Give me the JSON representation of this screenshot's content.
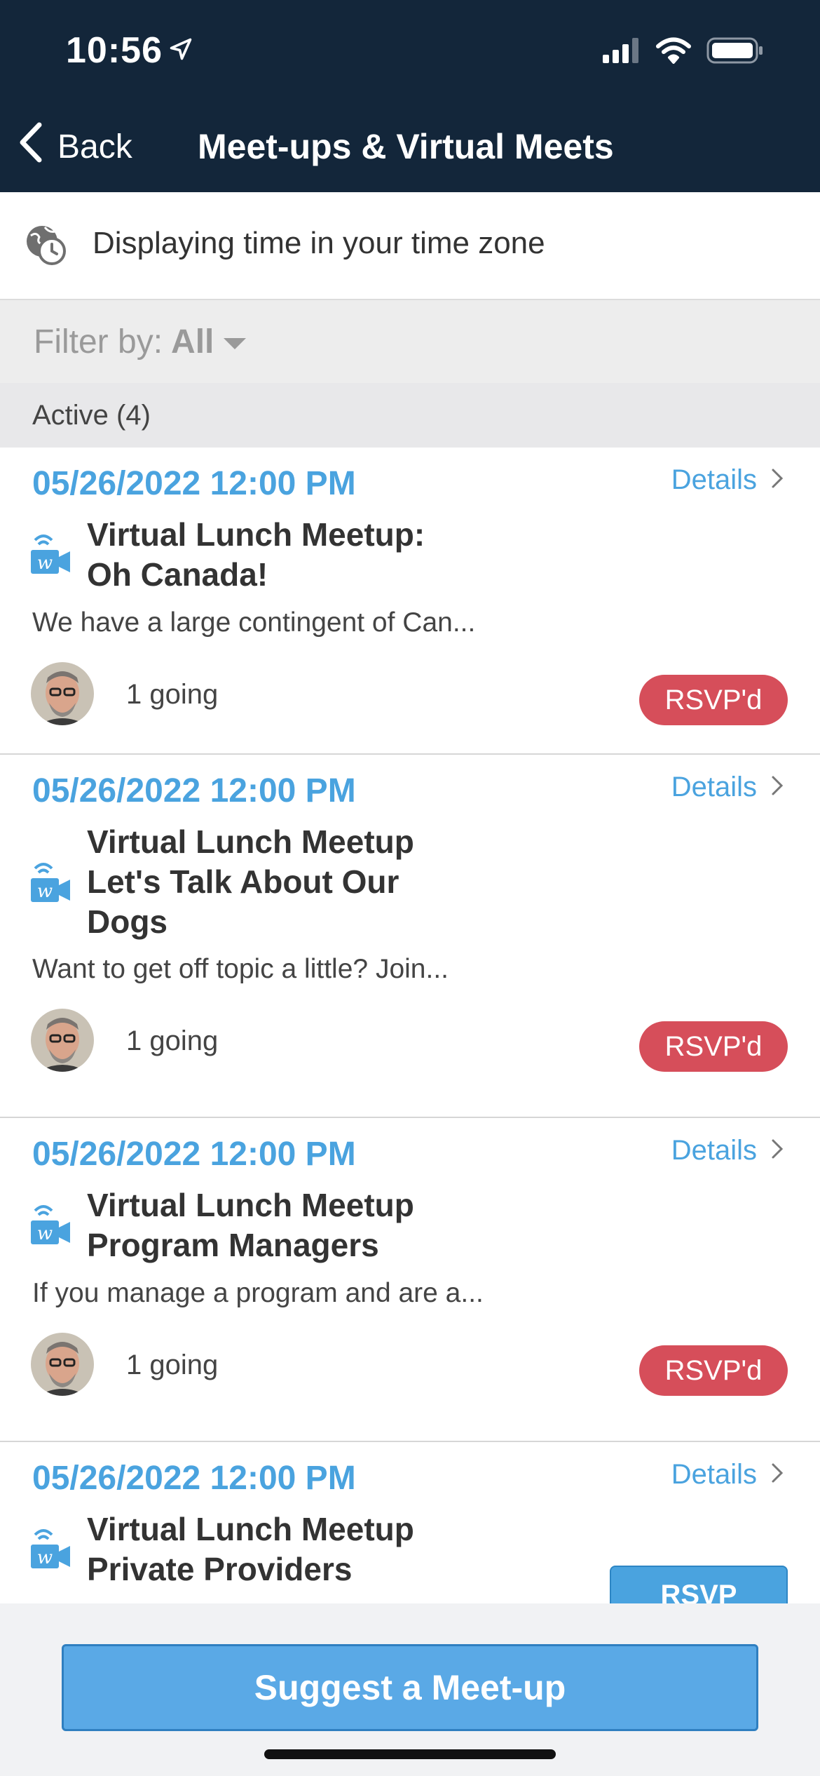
{
  "status": {
    "time": "10:56"
  },
  "nav": {
    "back_label": "Back",
    "title": "Meet-ups & Virtual Meets"
  },
  "timezone": {
    "text": "Displaying time in your time zone"
  },
  "filter": {
    "prefix": "Filter by:",
    "value": "All"
  },
  "section": {
    "label": "Active (4)"
  },
  "details_label": "Details",
  "events": [
    {
      "datetime": "05/26/2022 12:00 PM",
      "title_lines": [
        "Virtual Lunch Meetup:",
        "Oh Canada!"
      ],
      "description": "We have a large contingent of Can...",
      "going": "1 going",
      "rsvp": "RSVP'd"
    },
    {
      "datetime": "05/26/2022 12:00 PM",
      "title_lines": [
        "Virtual Lunch Meetup",
        "Let's Talk About Our",
        "Dogs"
      ],
      "description": "Want to get off topic a little?  Join...",
      "going": "1 going",
      "rsvp": "RSVP'd"
    },
    {
      "datetime": "05/26/2022 12:00 PM",
      "title_lines": [
        "Virtual Lunch Meetup",
        "Program Managers"
      ],
      "description": "If you manage a program and are a...",
      "going": "1 going",
      "rsvp": "RSVP'd"
    },
    {
      "datetime": "05/26/2022 12:00 PM",
      "title_lines": [
        "Virtual Lunch Meetup",
        "Private Providers"
      ],
      "rsvp": "RSVP"
    }
  ],
  "suggest_button": "Suggest a Meet-up",
  "colors": {
    "nav_bg": "#13263a",
    "accent": "#4aa3df",
    "rsvp_badge": "#d64e5a"
  },
  "icons": [
    "location-arrow-icon",
    "signal-icon",
    "wifi-icon",
    "battery-icon",
    "chevron-left-icon",
    "globe-clock-icon",
    "virtual-meet-icon",
    "chevron-right-icon"
  ]
}
